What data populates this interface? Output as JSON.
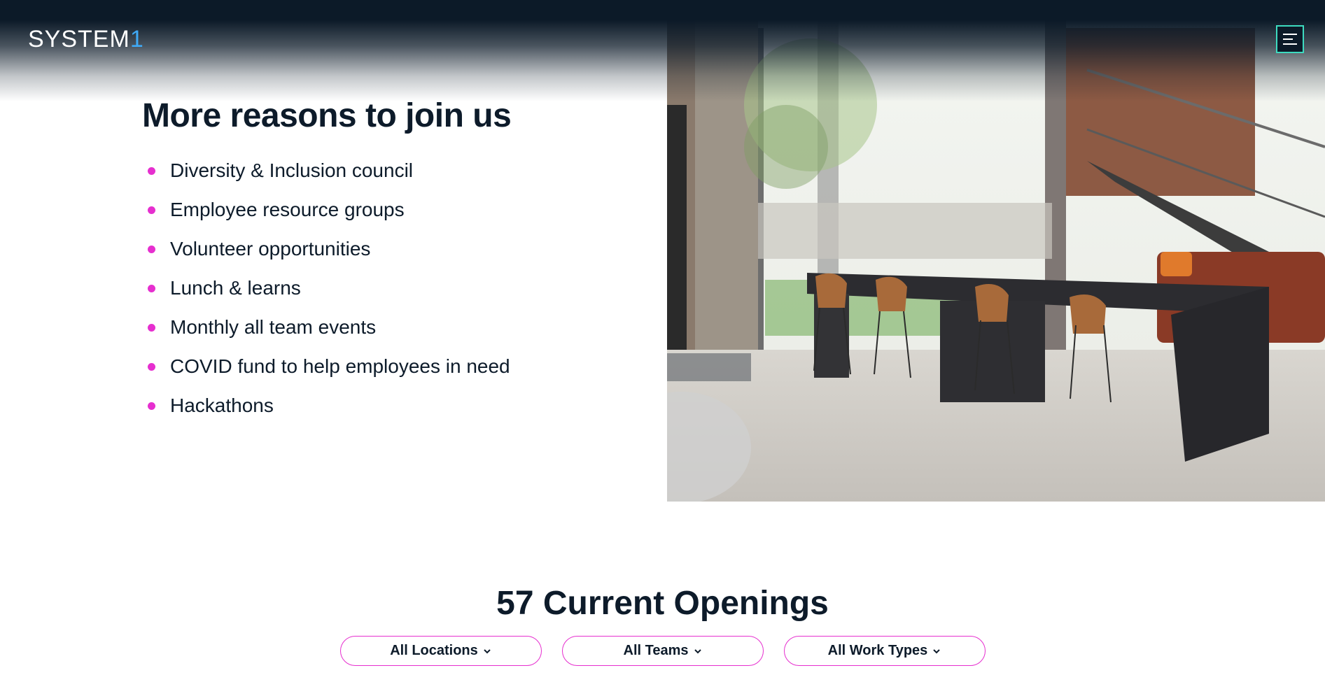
{
  "header": {
    "logo_text": "SYSTEM",
    "logo_accent": "1",
    "menu_icon": "hamburger-menu-icon"
  },
  "reasons": {
    "title": "More reasons to join us",
    "items": [
      "Diversity & Inclusion council",
      "Employee resource groups",
      "Volunteer opportunities",
      "Lunch & learns",
      "Monthly all team events",
      "COVID fund to help employees in need",
      "Hackathons"
    ]
  },
  "photo": {
    "subject": "office-interior-image"
  },
  "openings": {
    "title": "57 Current Openings",
    "filters": [
      {
        "label": "All Locations"
      },
      {
        "label": "All Teams"
      },
      {
        "label": "All Work Types"
      }
    ]
  },
  "colors": {
    "navy": "#0c1a28",
    "accent_pink": "#e62fcf",
    "accent_teal": "#3ddbc0",
    "logo_blue": "#3fa9f5"
  }
}
